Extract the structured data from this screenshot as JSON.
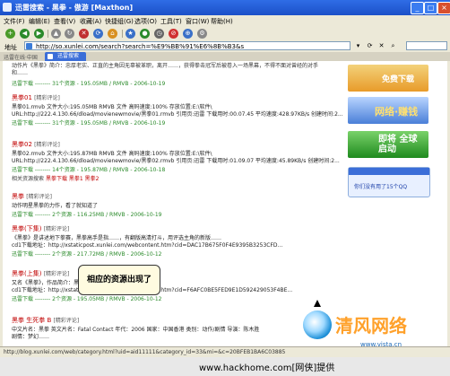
{
  "window": {
    "title": "迅雷搜索 - 黑拳 - 傲游 [Maxthon]",
    "controls": [
      "_",
      "□",
      "×"
    ]
  },
  "menu": [
    "文件(F)",
    "编辑(E)",
    "查看(V)",
    "收藏(A)",
    "快捷组(G)",
    "选项(O)",
    "工具(T)",
    "窗口(W)",
    "帮助(H)"
  ],
  "address": {
    "label": "地址",
    "url": "http://so.xunlei.com/search?search=%E9%BB%91%E6%8B%B3&s"
  },
  "tabs": {
    "label": "迅雷在线·中国",
    "active": "迅雷搜索"
  },
  "results": {
    "intro": "动作片《黑拳》简介：忠厚老实、正直的主角因无辜被革职，离开……，获得拳击冠军后被卷入一场黑幕，不得不面对曾经的对手和……",
    "items": [
      {
        "title": "黑拳01",
        "tag": "[精彩评论]",
        "file": "黑拳01.rmvb 文件大小:195.05MB RMVB 文件 高码速度:100% 存放位置:E:\\软件\\",
        "url": "URL:http://222.4.130.66/dload/movienewmovie/黑拳01.rmvb 引用页:迅雷 下载用时:00.07.45 平均速度:428.97KB/s 创建时间:2...",
        "meta": "迅雷下载 -------- 31个资源 - 195.05MB / RMVB - 2006-10-19"
      },
      {
        "title": "黑拳02",
        "tag": "[精彩评论]",
        "file": "黑拳02.rmvb 文件大小:195.87MB RMVB 文件 高码速度:100% 存放位置:E:\\软件\\",
        "url": "URL:http://222.4.130.66/dload/movienewmovie/黑拳02.rmvb 引用页:迅雷 下载用时:01.09.07 平均速度:45.89KB/s 创建时间:2...",
        "meta": "迅雷下载 -------- 14个资源 - 195.87MB / RMVB - 2006-10-18"
      },
      {
        "title": "黑拳",
        "tag": "[精彩评论]",
        "file": "动作明星黑拳的力作，看了就知道了",
        "url": "",
        "meta": "迅雷下载 -------- 2个资源 - 116.25MB / RMVB - 2006-10-19"
      },
      {
        "title": "黑拳(下集)",
        "tag": "[精彩评论]",
        "file": "《黑拳》是讲述地下拳赛，黑拳高手是指……，有翻版高清打斗，用评选主角的新版……",
        "url": "cd1下载地址：http://xstaticpost.xunlei.com/webcontent.htm?cid=DAC17B675F0F4E9395B3253CFD...",
        "meta": "迅雷下载 -------- 2个资源 - 217.72MB / RMVB - 2006-10-12"
      },
      {
        "title": "黑拳(上集)",
        "tag": "[精彩评论]",
        "file": "又名《黑拳》，作品简介：黑拳是……，新版……",
        "url": "cd1下载地址：http://xstaticpost.xunlei.com/webcontent.htm?cid=F6AFC0BE5FED9E1D592429053F4BE...",
        "meta": "迅雷下载 -------- 2个资源 - 195.05MB / RMVB - 2006-10-12"
      },
      {
        "title": "黑拳 生死拳 B",
        "tag": "[精彩评论]",
        "file": "中文片名：黑拳 英文片名：Fatal Contact 年代：2006 国家：中国香港 类别：动作/剧情 导演：陈木胜",
        "url": "剧情：梦幻……",
        "meta": ""
      }
    ],
    "links_prefix": "相关资源搜索",
    "links": [
      "黑拳下载",
      "黑拳1",
      "黑拳2"
    ]
  },
  "ads": [
    {
      "text": "免费下载"
    },
    {
      "text": "网络·赚钱"
    },
    {
      "text": "即将 全球启动"
    }
  ],
  "qq": {
    "message": "你们没有用了15个QQ"
  },
  "callout": "相应的资源出现了",
  "watermark": {
    "brand": "清风网络",
    "url": "www.vista.cn"
  },
  "status": "http://blog.xunlei.com/web/category.html?uid=aid11111&category_id=33&mi=&c=20BFEB1BA6C03885",
  "footer": "www.hackhome.com[网侠]提供"
}
